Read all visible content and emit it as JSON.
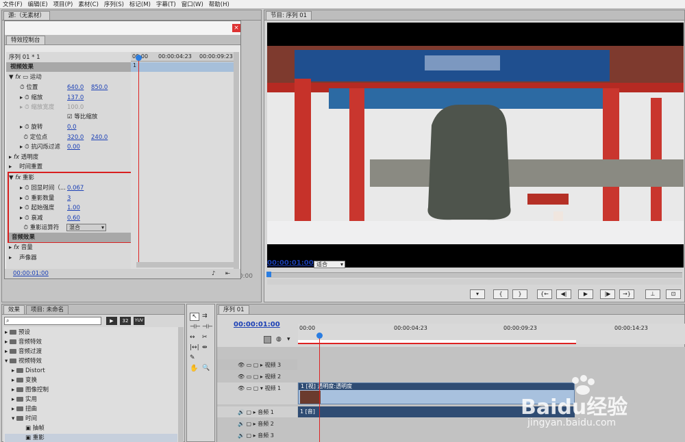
{
  "menu": [
    "文件(F)",
    "编辑(E)",
    "项目(P)",
    "素材(C)",
    "序列(S)",
    "标记(M)",
    "字幕(T)",
    "窗口(W)",
    "帮助(H)"
  ],
  "source_tab": "源:（无素材）",
  "effect_controls": {
    "tab": "特效控制台",
    "sequence": "序列 01 * 1",
    "ruler": [
      "00:00",
      "00:00:04:23",
      "00:00:09:23"
    ],
    "video_effects": "视频效果",
    "motion": "运动",
    "position": {
      "label": "位置",
      "x": "640.0",
      "y": "850.0"
    },
    "scale": {
      "label": "缩放",
      "value": "137.0"
    },
    "scale_width": {
      "label": "缩放宽度",
      "value": "100.0"
    },
    "uniform_scale": "等比缩放",
    "rotation": {
      "label": "旋转",
      "value": "0.0"
    },
    "anchor": {
      "label": "定位点",
      "x": "320.0",
      "y": "240.0"
    },
    "antiflicker": {
      "label": "抗闪烁过滤",
      "value": "0.00"
    },
    "opacity": "透明度",
    "time_remap": "时间重置",
    "echo": "重影",
    "echo_time": {
      "label": "回显时间（...",
      "value": "0.067"
    },
    "echo_count": {
      "label": "重影数量",
      "value": "3"
    },
    "start_intensity": {
      "label": "起始强度",
      "value": "1.00"
    },
    "decay": {
      "label": "衰减",
      "value": "0.60"
    },
    "echo_operator": {
      "label": "重影运算符",
      "value": "混合"
    },
    "audio_effects": "音频效果",
    "volume": "音量",
    "panner": "声像器",
    "timecode": "00:00:01:00",
    "marker": "1"
  },
  "source_time": "00:00",
  "program": {
    "tab": "节目: 序列 01",
    "timecode": "00:00:01:00",
    "fit": "适合"
  },
  "effects_panel": {
    "tabs": [
      "效果",
      "项目: 未命名"
    ],
    "items": [
      "预设",
      "音频特效",
      "音频过渡",
      "视频特效",
      "Distort",
      "变换",
      "图像控制",
      "实用",
      "扭曲",
      "时间",
      "抽帧",
      "重影"
    ]
  },
  "timeline": {
    "tab": "序列 01",
    "timecode": "00:00:01:00",
    "ruler": [
      "00:00",
      "00:00:04:23",
      "00:00:09:23",
      "00:00:14:23"
    ],
    "tracks": [
      "视频 3",
      "视频 2",
      "视频 1",
      "音频 1",
      "音频 2",
      "音频 3"
    ],
    "video_clip": "1 [视] 透明度:透明度",
    "audio_clip": "1 [音]"
  },
  "watermark": {
    "brand": "Baidu经验",
    "url": "jingyan.baidu.com"
  }
}
